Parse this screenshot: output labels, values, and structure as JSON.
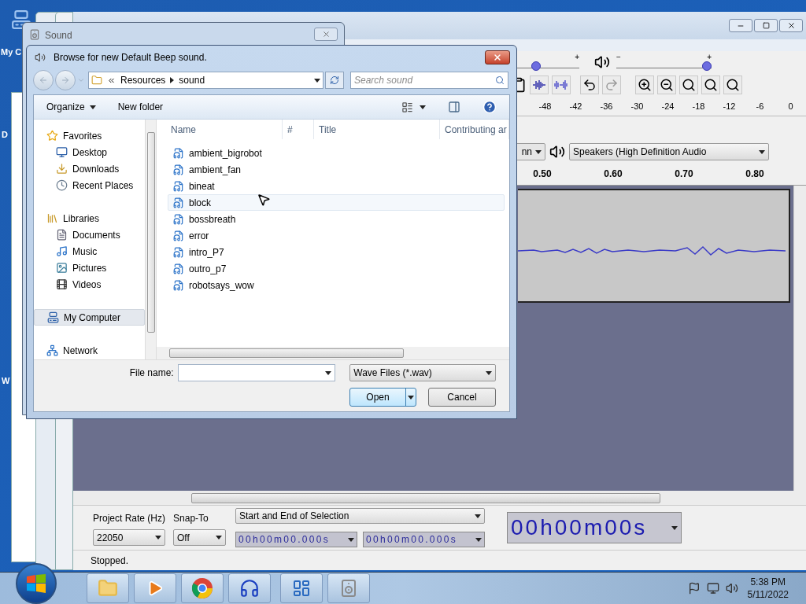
{
  "desktop": {
    "icon_labels": [
      "My C",
      "D",
      "W"
    ]
  },
  "sound_window": {
    "title": "Sound"
  },
  "audacity": {
    "sliders": [
      {
        "max_label": "+",
        "level": 0.68
      },
      {
        "min_label": "−",
        "max_label": "+",
        "level": 1
      }
    ],
    "meter_scale": [
      "-48",
      "-42",
      "-36",
      "-30",
      "-24",
      "-18",
      "-12",
      "-6",
      "0"
    ],
    "devices": {
      "host": "nn",
      "output": "Speakers (High Definition Audio"
    },
    "timeline": [
      "0.50",
      "0.60",
      "0.70",
      "0.80"
    ],
    "selection_toolbar": {
      "project_rate_label": "Project Rate (Hz)",
      "snap_label": "Snap-To",
      "project_rate": "22050",
      "snap": "Off",
      "selection_mode": "Start and End of Selection",
      "start_time": "00h00m00.000s",
      "end_time": "00h00m00.000s"
    },
    "audio_position": "00h00m00s",
    "status": "Stopped."
  },
  "dialog": {
    "title": "Browse for new Default Beep sound.",
    "breadcrumb": [
      "Resources",
      "sound"
    ],
    "search_placeholder": "Search sound",
    "toolbar": [
      "Organize",
      "New folder"
    ],
    "nav": [
      {
        "label": "Favorites",
        "kind": "favorites",
        "selected": false,
        "children": [
          {
            "label": "Desktop",
            "kind": "desktop",
            "selected": false
          },
          {
            "label": "Downloads",
            "kind": "downloads",
            "selected": false
          },
          {
            "label": "Recent Places",
            "kind": "recent",
            "selected": false
          }
        ]
      },
      {
        "label": "Libraries",
        "kind": "libraries",
        "selected": false,
        "children": [
          {
            "label": "Documents",
            "kind": "documents",
            "selected": false
          },
          {
            "label": "Music",
            "kind": "music",
            "selected": false
          },
          {
            "label": "Pictures",
            "kind": "pictures",
            "selected": false
          },
          {
            "label": "Videos",
            "kind": "videos",
            "selected": false
          }
        ]
      },
      {
        "label": "My Computer",
        "kind": "computer",
        "selected": true
      },
      {
        "label": "Network",
        "kind": "network",
        "selected": false
      }
    ],
    "columns": [
      "Name",
      "#",
      "Title",
      "Contributing ar"
    ],
    "files": [
      {
        "name": "ambient_bigrobot",
        "hovered": false
      },
      {
        "name": "ambient_fan",
        "hovered": false
      },
      {
        "name": "bineat",
        "hovered": false
      },
      {
        "name": "block",
        "hovered": true
      },
      {
        "name": "bossbreath",
        "hovered": false
      },
      {
        "name": "error",
        "hovered": false
      },
      {
        "name": "intro_P7",
        "hovered": false
      },
      {
        "name": "outro_p7",
        "hovered": false
      },
      {
        "name": "robotsays_wow",
        "hovered": false
      }
    ],
    "file_name_label": "File name:",
    "file_type": "Wave Files (*.wav)",
    "buttons": [
      "Open",
      "Cancel"
    ]
  },
  "taskbar": {
    "time": "5:38 PM",
    "date": "5/11/2022"
  }
}
